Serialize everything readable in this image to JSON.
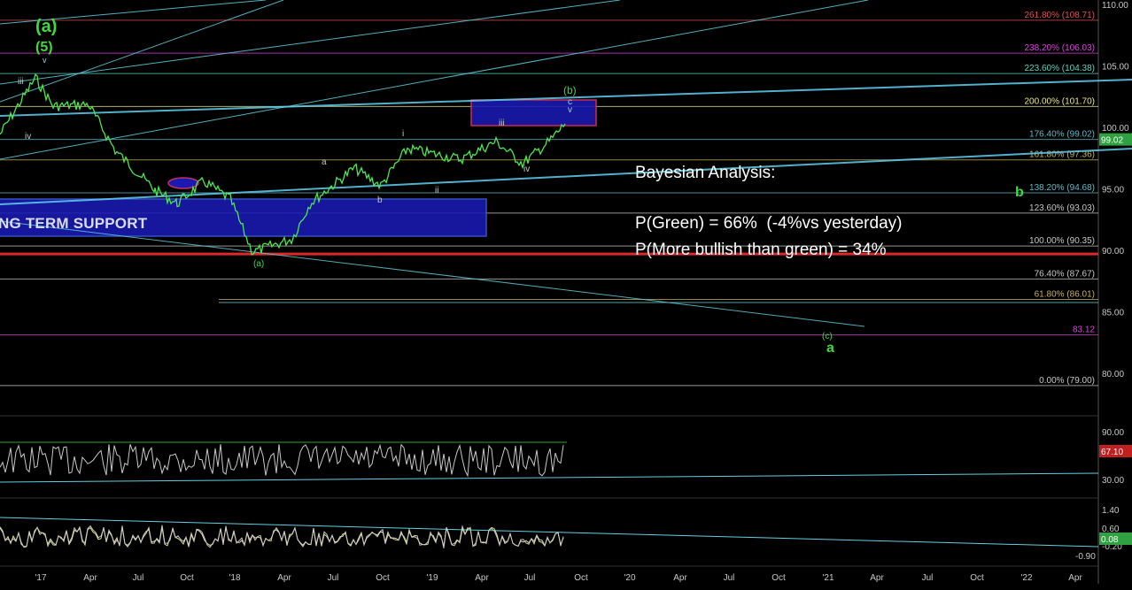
{
  "chart_data": {
    "type": "line",
    "price_axis": {
      "min": 78,
      "max": 110,
      "ticks": [
        "110.00",
        "105.00",
        "100.00",
        "95.00",
        "90.00",
        "85.00",
        "80.00"
      ]
    },
    "time_axis_labels": [
      "'17",
      "Apr",
      "Jul",
      "Oct",
      "'18",
      "Apr",
      "Jul",
      "Oct",
      "'19",
      "Apr",
      "Jul",
      "Oct",
      "'20",
      "Apr",
      "Jul",
      "Oct",
      "'21",
      "Apr",
      "Jul",
      "Oct",
      "'22",
      "Apr"
    ],
    "last_price": "99.02",
    "fib_levels": [
      {
        "label": "261.80% (108.71)",
        "value": 108.71,
        "color": "#e05050"
      },
      {
        "label": "238.20% (106.03)",
        "value": 106.03,
        "color": "#e040e0"
      },
      {
        "label": "223.60% (104.38)",
        "value": 104.38,
        "color": "#5fd0c0"
      },
      {
        "label": "200.00% (101.70)",
        "value": 101.7,
        "color": "#e8e890"
      },
      {
        "label": "176.40% (99.02)",
        "value": 99.02,
        "color": "#5fb8c8"
      },
      {
        "label": "161.80% (97.36)",
        "value": 97.36,
        "color": "#c8b060"
      },
      {
        "label": "138.20% (94.68)",
        "value": 94.68,
        "color": "#5fb8c8"
      },
      {
        "label": "123.60% (93.03)",
        "value": 93.03,
        "color": "#c8c8c8"
      },
      {
        "label": "100.00% (90.35)",
        "value": 90.35,
        "color": "#c8c8c8"
      },
      {
        "label": "76.40% (87.67)",
        "value": 87.67,
        "color": "#c8c8c8"
      },
      {
        "label": "61.80% (86.01)",
        "value": 86.01,
        "color": "#c8b060"
      },
      {
        "label": "83.12",
        "value": 83.12,
        "color": "#e040e0"
      },
      {
        "label": "0.00% (79.00)",
        "value": 79.0,
        "color": "#c8c8c8"
      }
    ],
    "support_line_value": 89.7,
    "support_label": "NG TERM SUPPORT",
    "wave_labels": [
      {
        "text": "(a)",
        "color": "#3cdc3c"
      },
      {
        "text": "(5)",
        "color": "#3cdc3c"
      },
      {
        "text": "v",
        "color": "#9fd0d8"
      },
      {
        "text": "iii",
        "color": "#c8c8c8"
      },
      {
        "text": "iv",
        "color": "#c8c8c8"
      },
      {
        "text": "(a)",
        "color": "#3cdc3c"
      },
      {
        "text": "a",
        "color": "#c8c8c8"
      },
      {
        "text": "b",
        "color": "#c8c8c8"
      },
      {
        "text": "i",
        "color": "#c8c8c8"
      },
      {
        "text": "ii",
        "color": "#c8c8c8"
      },
      {
        "text": "iii",
        "color": "#c8c8c8"
      },
      {
        "text": "iv",
        "color": "#c8c8c8"
      },
      {
        "text": "(b)",
        "color": "#3cdc3c"
      },
      {
        "text": "c",
        "color": "#9fd0d8"
      },
      {
        "text": "v",
        "color": "#9fd0d8"
      },
      {
        "text": "b",
        "color": "#3cdc3c"
      },
      {
        "text": "(c)",
        "color": "#3cdc3c"
      },
      {
        "text": "a",
        "color": "#3cdc3c"
      }
    ],
    "rsi_ticks": [
      "90.00",
      "30.00"
    ],
    "rsi_last": "67.10",
    "macd_ticks": [
      "1.40",
      "0.60",
      "-0.20",
      "-0.90"
    ],
    "macd_last": "0.08"
  },
  "annotation": {
    "title": "Bayesian Analysis:",
    "line1": "P(Green) = 66%  (-4%vs yesterday)",
    "line2": "P(More bullish than green) = 34%"
  }
}
